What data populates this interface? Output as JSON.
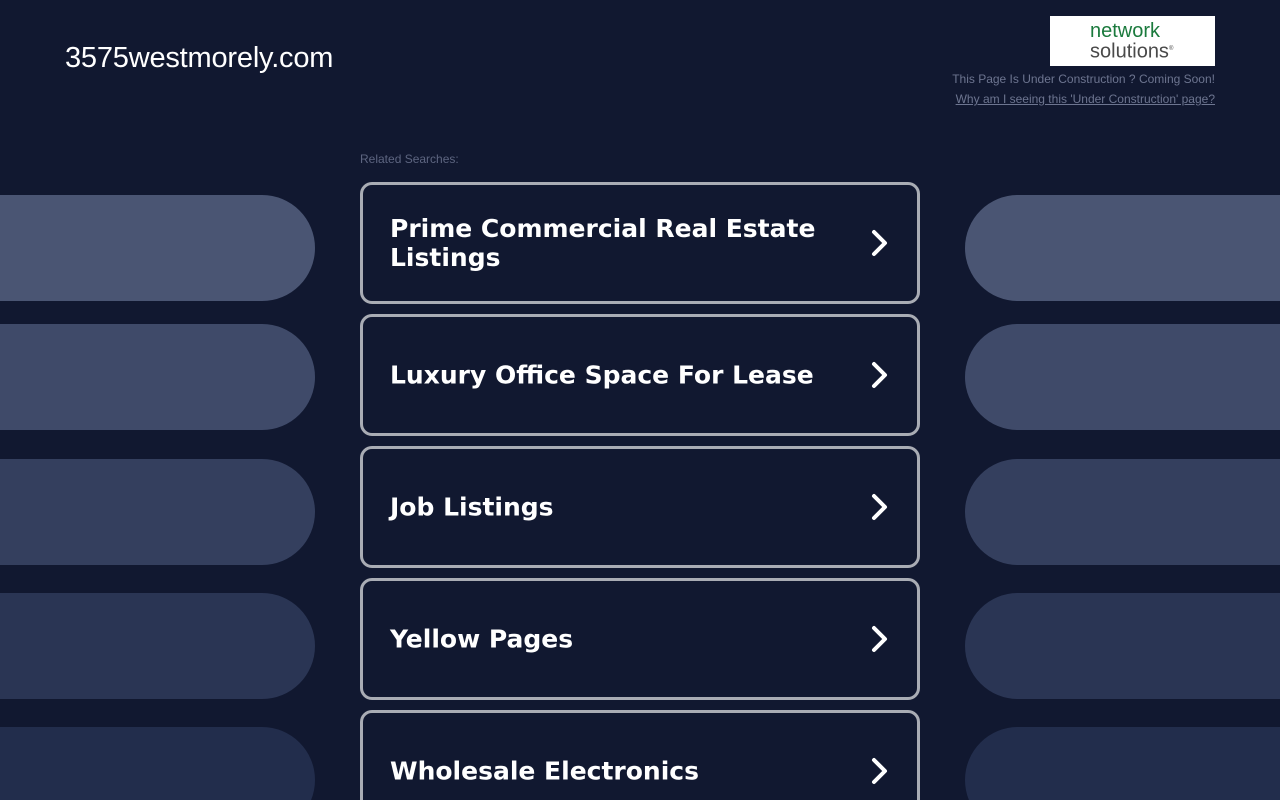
{
  "header": {
    "domain": "3575westmorely.com",
    "logo_line1": "network",
    "logo_line2": "solutions",
    "logo_reg": "®",
    "under_construction": "This Page Is Under Construction ? Coming Soon!",
    "why_link": "Why am I seeing this 'Under Construction' page?"
  },
  "related": {
    "label": "Related Searches:",
    "items": [
      {
        "label": "Prime Commercial Real Estate Listings"
      },
      {
        "label": "Luxury Office Space For Lease"
      },
      {
        "label": "Job Listings"
      },
      {
        "label": "Yellow Pages"
      },
      {
        "label": "Wholesale Electronics"
      }
    ]
  },
  "colors": {
    "background": "#111830",
    "card_border": "#a9acb4",
    "logo_green": "#1b7a3d"
  },
  "icons": {
    "card_arrow": "chevron-right-icon"
  }
}
